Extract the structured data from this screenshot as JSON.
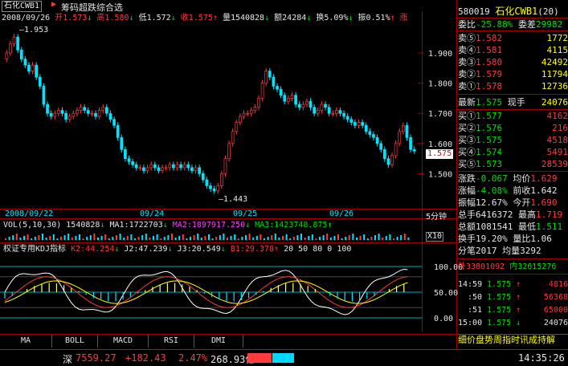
{
  "header": {
    "stock_name": "石化CWB1",
    "indicator_title": "筹码超跌综合选",
    "date": "2008/09/26",
    "open_label": "开",
    "open": "1.573",
    "high_label": "高",
    "high": "1.580",
    "low_label": "低",
    "low": "1.572",
    "close_label": "收",
    "close": "1.575",
    "volume_label": "量",
    "volume": "1540828",
    "amount_label": "额",
    "amount": "24284",
    "turnover_label": "换",
    "turnover": "5.09%",
    "amplitude_label": "振",
    "amplitude": "0.51%",
    "change_label": "涨"
  },
  "main_chart": {
    "price_ticks": [
      "1.900",
      "1.800",
      "1.700",
      "1.600",
      "1.500"
    ],
    "high_marker": "1.953",
    "low_marker": "1.443",
    "current_price": "1.575",
    "date_ticks": [
      "2008/09/22",
      "09/24",
      "09/25",
      "09/26"
    ],
    "period": "5分钟"
  },
  "volume_line": {
    "title": "VOL(5,10,30)",
    "vol": "1540828",
    "ma1": "MA1:1722703",
    "ma2": "MA2:1897917.250",
    "ma3": "MA3:1423748.875",
    "scale": "X10"
  },
  "kdj": {
    "title": "权证专用KDJ指标",
    "k2": "K2:44.254",
    "j2": "J2:47.239",
    "j3": "J3:20.549",
    "b1": "B1:29.378",
    "constants": "20 50 80 0 100",
    "ticks": [
      "100.00",
      "50.00",
      "0.00"
    ]
  },
  "tabs": [
    "MA",
    "BOLL",
    "MACD",
    "RSI",
    "DMI"
  ],
  "status_bar": {
    "market": "深",
    "index": "7559.27",
    "change": "+182.43",
    "pct": "2.47%",
    "amount": "268.93亿",
    "time": "14:35:26"
  },
  "quote_panel": {
    "code": "580019",
    "name": "石化CWB1",
    "count": "(20)",
    "weibi_label": "委比",
    "weibi": "-25.88%",
    "weicha_label": "委差",
    "weicha": "29982",
    "asks": [
      {
        "label": "卖⑤",
        "price": "1.582",
        "vol": "1772"
      },
      {
        "label": "卖④",
        "price": "1.581",
        "vol": "4115"
      },
      {
        "label": "卖③",
        "price": "1.580",
        "vol": "42492"
      },
      {
        "label": "卖②",
        "price": "1.579",
        "vol": "11794"
      },
      {
        "label": "卖①",
        "price": "1.578",
        "vol": "12736"
      }
    ],
    "last_label": "最新",
    "last": "1.575",
    "hand_label": "现手",
    "hand": "24076",
    "bids": [
      {
        "label": "买①",
        "price": "1.577",
        "vol": "4162"
      },
      {
        "label": "买②",
        "price": "1.576",
        "vol": "216"
      },
      {
        "label": "买③",
        "price": "1.575",
        "vol": "4518"
      },
      {
        "label": "买④",
        "price": "1.574",
        "vol": "5491"
      },
      {
        "label": "买⑤",
        "price": "1.573",
        "vol": "28539"
      }
    ],
    "stats": [
      {
        "l1": "涨跌",
        "v1": "-0.067",
        "l2": "均价",
        "v2": "1.629"
      },
      {
        "l1": "涨幅",
        "v1": "-4.08%",
        "l2": "前收",
        "v2": "1.642"
      },
      {
        "l1": "振幅",
        "v1": "12.67%",
        "l2": "今开",
        "v2": "1.690"
      },
      {
        "l1": "总手",
        "v1": "6416372",
        "l2": "最高",
        "v2": "1.719"
      },
      {
        "l1": "总额",
        "v1": "1081541",
        "l2": "最低",
        "v2": "1.511"
      },
      {
        "l1": "换手",
        "v1": "19.20%",
        "l2": "量比",
        "v2": "1.06"
      },
      {
        "l1": "分笔",
        "v1": "2017",
        "l2": "均量",
        "v2": "3292"
      }
    ],
    "outer_inner": {
      "outer": "33801092",
      "inner": "32615276"
    },
    "trades": [
      {
        "time": "14:59",
        "price": "1.575",
        "vol": "4816"
      },
      {
        "time": ":50",
        "price": "1.575",
        "vol": "56368"
      },
      {
        "time": ":51",
        "price": "1.575",
        "vol": "65000"
      },
      {
        "time": "15:00",
        "price": "1.575",
        "vol": "24076"
      }
    ],
    "bottom_tabs": "细价盘势周指时讯成持解"
  },
  "chart_data": [
    {
      "type": "candlestick",
      "title": "石化CWB1",
      "x": [
        "2008/09/22",
        "09/24",
        "09/25",
        "09/26"
      ],
      "ylim": [
        1.443,
        1.953
      ],
      "y_ticks": [
        1.9,
        1.8,
        1.7,
        1.6,
        1.5
      ],
      "annotations": {
        "high": 1.953,
        "low": 1.443,
        "last": 1.575
      },
      "series": [
        {
          "values": [
            1.9,
            1.93,
            1.953,
            1.91,
            1.88,
            1.86,
            1.84,
            1.86,
            1.82,
            1.79,
            1.73,
            1.7,
            1.69,
            1.7,
            1.71,
            1.7,
            1.68,
            1.69,
            1.7,
            1.71,
            1.72,
            1.71,
            1.7,
            1.7,
            1.69,
            1.71,
            1.72,
            1.7,
            1.68,
            1.66,
            1.62,
            1.58,
            1.55,
            1.54,
            1.53,
            1.52,
            1.52,
            1.51,
            1.52,
            1.53,
            1.52,
            1.51,
            1.52,
            1.52,
            1.53,
            1.52,
            1.53,
            1.52,
            1.53,
            1.52,
            1.51,
            1.52,
            1.5,
            1.48,
            1.46,
            1.45,
            1.443,
            1.46,
            1.5,
            1.55,
            1.6,
            1.64,
            1.67,
            1.69,
            1.7,
            1.7,
            1.71,
            1.72,
            1.75,
            1.8,
            1.84,
            1.82,
            1.79,
            1.78,
            1.76,
            1.74,
            1.75,
            1.76,
            1.73,
            1.72,
            1.73,
            1.74,
            1.72,
            1.7,
            1.71,
            1.73,
            1.72,
            1.7,
            1.7,
            1.71,
            1.7,
            1.69,
            1.68,
            1.67,
            1.66,
            1.67,
            1.66,
            1.64,
            1.63,
            1.62,
            1.6,
            1.58,
            1.55,
            1.53,
            1.56,
            1.6,
            1.64,
            1.66,
            1.62,
            1.58,
            1.575
          ]
        }
      ]
    }
  ]
}
